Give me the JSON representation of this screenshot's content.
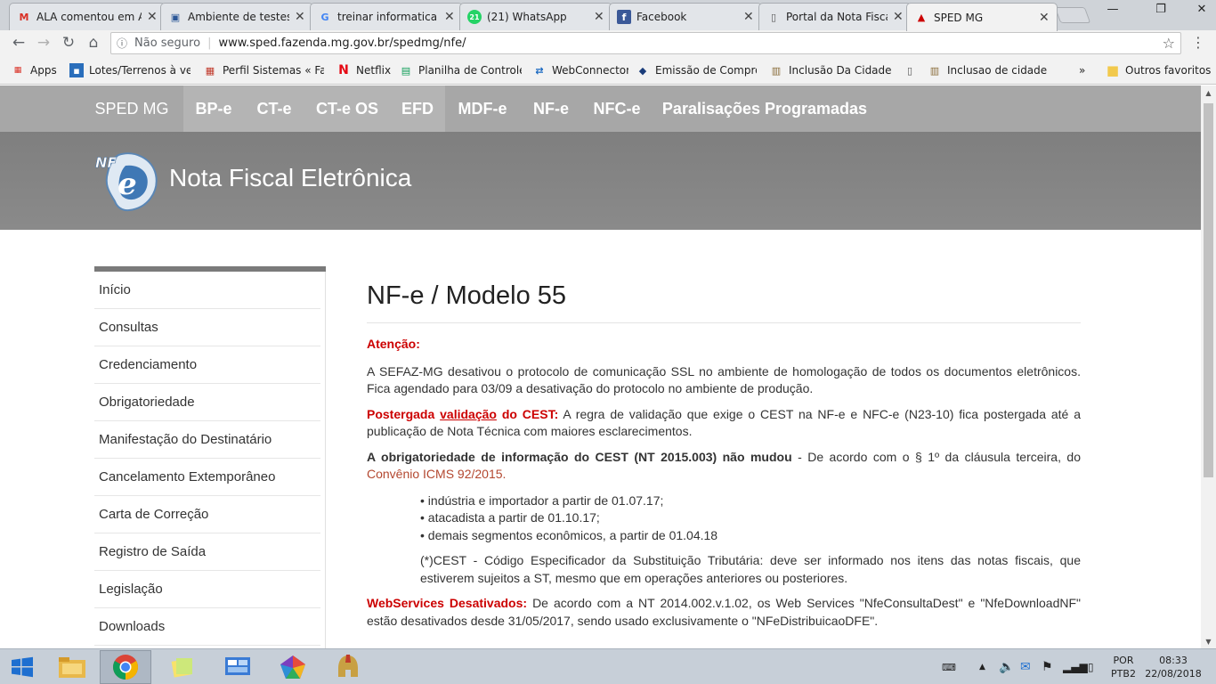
{
  "browser": {
    "tabs": [
      {
        "title": "ALA comentou em A",
        "icon": "gmail-icon",
        "glyph": "M",
        "color": "#d93025"
      },
      {
        "title": "Ambiente de testes",
        "icon": "page-icon",
        "glyph": "▣",
        "color": "#2b5797"
      },
      {
        "title": "treinar informatica ja",
        "icon": "google-icon",
        "glyph": "G",
        "color": "#4285f4"
      },
      {
        "title": "(21) WhatsApp",
        "icon": "whatsapp-icon",
        "glyph": "21",
        "color": "#25d366"
      },
      {
        "title": "Facebook",
        "icon": "facebook-icon",
        "glyph": "f",
        "color": "#3b5998"
      },
      {
        "title": "Portal da Nota Fiscal",
        "icon": "document-icon",
        "glyph": "▯",
        "color": "#555555"
      },
      {
        "title": "SPED MG",
        "icon": "sped-icon",
        "glyph": "▲",
        "color": "#cc0000"
      }
    ],
    "address": {
      "security": "Não seguro",
      "url": "www.sped.fazenda.mg.gov.br/spedmg/nfe/"
    },
    "bookmarks": [
      {
        "label": "Apps",
        "icon": "apps-icon",
        "glyph": "⁞⁞⁞",
        "color": "#d93025"
      },
      {
        "label": "Lotes/Terrenos à venda",
        "icon": "bookmark-page-icon",
        "glyph": "■",
        "color": "#2a6ebb"
      },
      {
        "label": "Perfil Sistemas « Faze",
        "icon": "bookmark-page-icon",
        "glyph": "▦",
        "color": "#c0392b"
      },
      {
        "label": "Netflix",
        "icon": "netflix-icon",
        "glyph": "N",
        "color": "#e50914"
      },
      {
        "label": "Planilha de Controle d",
        "icon": "sheets-icon",
        "glyph": "▤",
        "color": "#0f9d58"
      },
      {
        "label": "WebConnector",
        "icon": "webconnector-icon",
        "glyph": "⇄",
        "color": "#1565c0"
      },
      {
        "label": "Emissão de Comprova",
        "icon": "receita-icon",
        "glyph": "◆",
        "color": "#1a3c7a"
      },
      {
        "label": "Inclusão Da Cidade D",
        "icon": "bookmark-page-icon",
        "glyph": "▥",
        "color": "#8a6d3b"
      },
      {
        "label": "",
        "icon": "document-icon",
        "glyph": "▯",
        "color": "#555555"
      },
      {
        "label": "Inclusao de cidade -",
        "icon": "bookmark-page-icon",
        "glyph": "▥",
        "color": "#8a6d3b"
      }
    ],
    "more": "»",
    "other_favorites": "Outros favoritos"
  },
  "site": {
    "brand": "SPED MG",
    "nav": [
      "BP-e",
      "CT-e",
      "CT-e OS",
      "EFD",
      "MDF-e",
      "NF-e",
      "NFC-e",
      "Paralisações Programadas"
    ],
    "banner_title": "Nota Fiscal Eletrônica",
    "logo_text": "NF-e"
  },
  "sidebar": [
    "Início",
    "Consultas",
    "Credenciamento",
    "Obrigatoriedade",
    "Manifestação do Destinatário",
    "Cancelamento Extemporâneo",
    "Carta de Correção",
    "Registro de Saída",
    "Legislação",
    "Downloads"
  ],
  "content": {
    "heading": "NF-e / Modelo 55",
    "attention_label": "Atenção:",
    "attention_text": "A SEFAZ-MG desativou o protocolo de comunicação SSL no ambiente de homologação de todos os documentos eletrônicos. Fica agendado para 03/09 a desativação do protocolo no ambiente de produção.",
    "postponed_label_1": "Postergada ",
    "postponed_link": "validação",
    "postponed_label_2": " do CEST:",
    "postponed_text": " A regra de validação que exige o CEST na NF-e e NFC-e (N23-10) fica postergada até a publicação de Nota Técnica com maiores esclarecimentos.",
    "mandatory_label": "A obrigatoriedade de informação do CEST (NT 2015.003) não mudou",
    "mandatory_text": " - De acordo com o § 1º da cláusula terceira, do ",
    "convenio_link": "Convênio ICMS 92/2015.",
    "bullets": [
      "• indústria e importador a partir de 01.07.17;",
      "• atacadista a partir de 01.10.17;",
      "• demais segmentos econômicos, a partir de 01.04.18"
    ],
    "note": "(*)CEST - Código Especificador da Substituição Tributária: deve ser informado nos itens das notas fiscais, que estiverem sujeitos a ST, mesmo que em operações anteriores ou posteriores.",
    "ws_label": "WebServices Desativados:",
    "ws_text": " De acordo com a NT 2014.002.v.1.02, os Web Services \"NfeConsultaDest\" e \"NfeDownloadNF\" estão desativados desde 31/05/2017, sendo usado exclusivamente o \"NFeDistribuicaoDFE\"."
  },
  "taskbar": {
    "language": "POR",
    "layout": "PTB2",
    "time": "08:33",
    "date": "22/08/2018"
  }
}
